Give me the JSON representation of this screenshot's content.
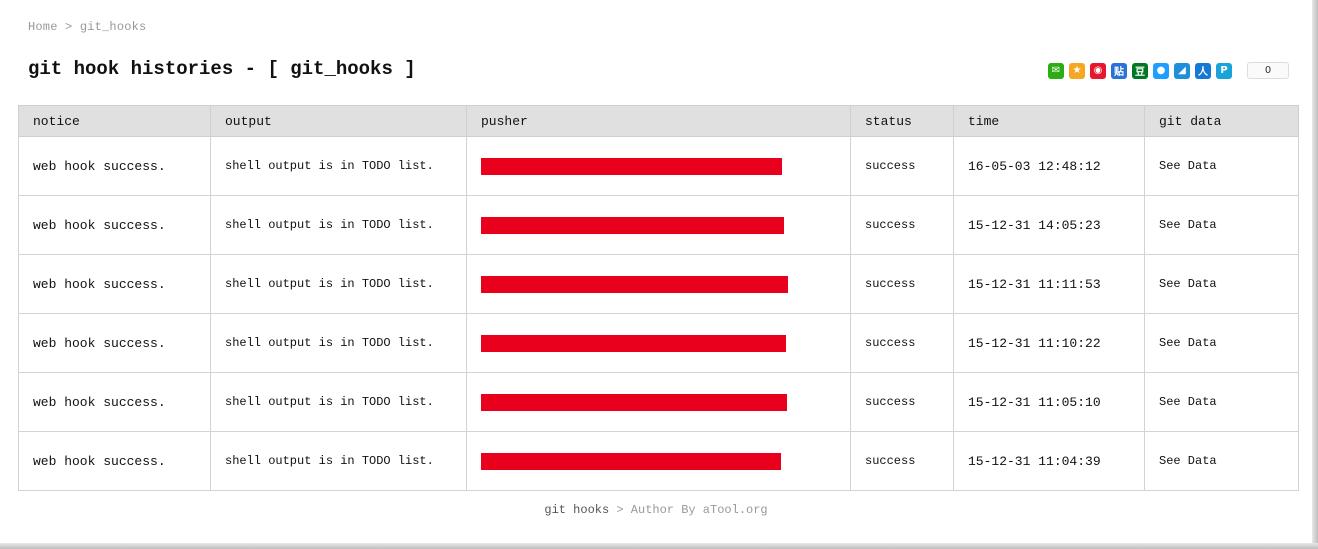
{
  "breadcrumb": {
    "home": "Home",
    "separator": ">",
    "current": "git_hooks"
  },
  "page": {
    "title": "git hook histories - [ git_hooks ]"
  },
  "share": {
    "icons": [
      {
        "name": "wechat-icon",
        "glyph": "✉",
        "color": "#2bad13"
      },
      {
        "name": "qzone-icon",
        "glyph": "★",
        "color": "#f5a623"
      },
      {
        "name": "weibo-icon",
        "glyph": "◉",
        "color": "#e6162d"
      },
      {
        "name": "tieba-icon",
        "glyph": "贴",
        "color": "#2b72d6"
      },
      {
        "name": "douban-icon",
        "glyph": "豆",
        "color": "#007722"
      },
      {
        "name": "qq-icon",
        "glyph": "●",
        "color": "#1e9fff"
      },
      {
        "name": "renren-icon",
        "glyph": "◢",
        "color": "#1f8fdb"
      },
      {
        "name": "kaixin-icon",
        "glyph": "人",
        "color": "#1478d4"
      },
      {
        "name": "pinterest-icon",
        "glyph": "P",
        "color": "#1aa3d9"
      }
    ],
    "count": "0"
  },
  "table": {
    "columns": [
      "notice",
      "output",
      "pusher",
      "status",
      "time",
      "git data"
    ],
    "rows": [
      {
        "notice": "web hook success.",
        "output": "shell output is in TODO list.",
        "status": "success",
        "time": "16-05-03 12:48:12",
        "link": "See Data"
      },
      {
        "notice": "web hook success.",
        "output": "shell output is in TODO list.",
        "status": "success",
        "time": "15-12-31 14:05:23",
        "link": "See Data"
      },
      {
        "notice": "web hook success.",
        "output": "shell output is in TODO list.",
        "status": "success",
        "time": "15-12-31 11:11:53",
        "link": "See Data"
      },
      {
        "notice": "web hook success.",
        "output": "shell output is in TODO list.",
        "status": "success",
        "time": "15-12-31 11:10:22",
        "link": "See Data"
      },
      {
        "notice": "web hook success.",
        "output": "shell output is in TODO list.",
        "status": "success",
        "time": "15-12-31 11:05:10",
        "link": "See Data"
      },
      {
        "notice": "web hook success.",
        "output": "shell output is in TODO list.",
        "status": "success",
        "time": "15-12-31 11:04:39",
        "link": "See Data"
      }
    ]
  },
  "footer": {
    "home": "git hooks",
    "separator": ">",
    "author": "Author By aTool.org"
  },
  "colors": {
    "redaction": "#e8001c",
    "status_success": "#2e8b2e",
    "header_bg": "#e0e0e0"
  }
}
